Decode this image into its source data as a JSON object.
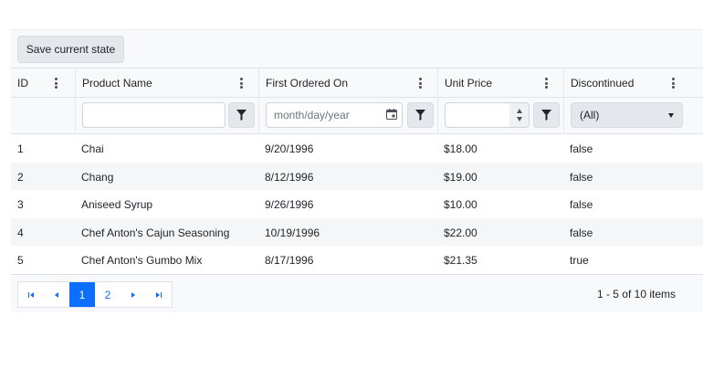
{
  "toolbar": {
    "save_label": "Save current state"
  },
  "columns": [
    {
      "key": "id",
      "title": "ID"
    },
    {
      "key": "product",
      "title": "Product Name"
    },
    {
      "key": "ordered",
      "title": "First Ordered On"
    },
    {
      "key": "price",
      "title": "Unit Price"
    },
    {
      "key": "discontinued",
      "title": "Discontinued"
    }
  ],
  "filters": {
    "product_value": "",
    "date_placeholder": "month/day/year",
    "price_value": "",
    "discontinued_selected": "(All)"
  },
  "rows": [
    {
      "id": "1",
      "product": "Chai",
      "ordered": "9/20/1996",
      "price": "$18.00",
      "discontinued": "false"
    },
    {
      "id": "2",
      "product": "Chang",
      "ordered": "8/12/1996",
      "price": "$19.00",
      "discontinued": "false"
    },
    {
      "id": "3",
      "product": "Aniseed Syrup",
      "ordered": "9/26/1996",
      "price": "$10.00",
      "discontinued": "false"
    },
    {
      "id": "4",
      "product": "Chef Anton's Cajun Seasoning",
      "ordered": "10/19/1996",
      "price": "$22.00",
      "discontinued": "false"
    },
    {
      "id": "5",
      "product": "Chef Anton's Gumbo Mix",
      "ordered": "8/17/1996",
      "price": "$21.35",
      "discontinued": "true"
    }
  ],
  "pager": {
    "pages": [
      "1",
      "2"
    ],
    "current_page": "1",
    "info": "1 - 5 of 10 items"
  },
  "colors": {
    "accent": "#0d6efd",
    "header_bg": "#f8f9fa",
    "alt_row": "#f5f6f7"
  },
  "icons": [
    "kebab-menu-icon",
    "filter-icon",
    "calendar-icon",
    "spin-up-icon",
    "spin-down-icon",
    "chevron-down-icon",
    "first-page-icon",
    "prev-page-icon",
    "next-page-icon",
    "last-page-icon"
  ]
}
